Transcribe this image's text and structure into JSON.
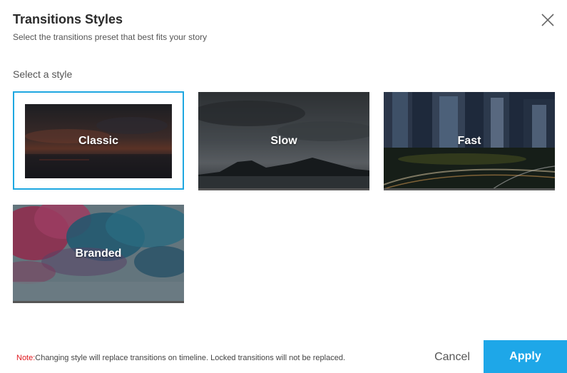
{
  "header": {
    "title": "Transitions Styles",
    "subtitle": "Select the transitions preset that best fits your story"
  },
  "section": {
    "label": "Select a style"
  },
  "styles": [
    {
      "label": "Classic",
      "selected": true
    },
    {
      "label": "Slow",
      "selected": false
    },
    {
      "label": "Fast",
      "selected": false
    },
    {
      "label": "Branded",
      "selected": false
    }
  ],
  "footer": {
    "note_label": "Note:",
    "note_text": "Changing style will replace transitions on timeline. Locked transitions will not be replaced.",
    "cancel_label": "Cancel",
    "apply_label": "Apply"
  },
  "colors": {
    "accent": "#1ea7e8",
    "note_red": "#e0191f"
  },
  "icons": {
    "close": "close-icon"
  }
}
